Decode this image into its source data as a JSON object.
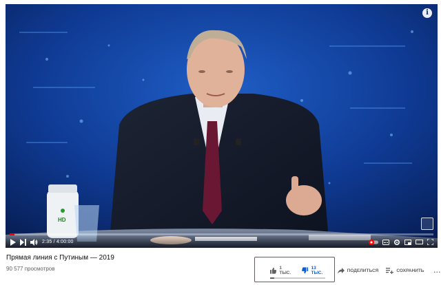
{
  "video": {
    "title": "Прямая линия с Путиным — 2019",
    "views": "90 577 просмотров",
    "current_time": "2:35",
    "duration": "4:00:00",
    "progress_fraction": 0.011,
    "info_label": "i",
    "mug_label": "HD"
  },
  "actions": {
    "like_count": "1 тыс.",
    "dislike_count": "13 тыс.",
    "share_label": "Поделиться",
    "save_label": "Сохранить",
    "more_label": "..."
  },
  "sentiment": {
    "like_fraction": 0.07
  },
  "colors": {
    "studio_blue": "#0a2a6e",
    "progress_red": "#ff0000",
    "dislike_blue": "#065fd4",
    "highlight_red": "#e0271e"
  },
  "icons": {
    "play": "play-icon",
    "next": "next-icon",
    "volume": "volume-icon",
    "like": "thumbs-up-icon",
    "dislike": "thumbs-down-icon",
    "share": "share-arrow-icon",
    "save": "playlist-add-icon",
    "more": "more-icon"
  }
}
